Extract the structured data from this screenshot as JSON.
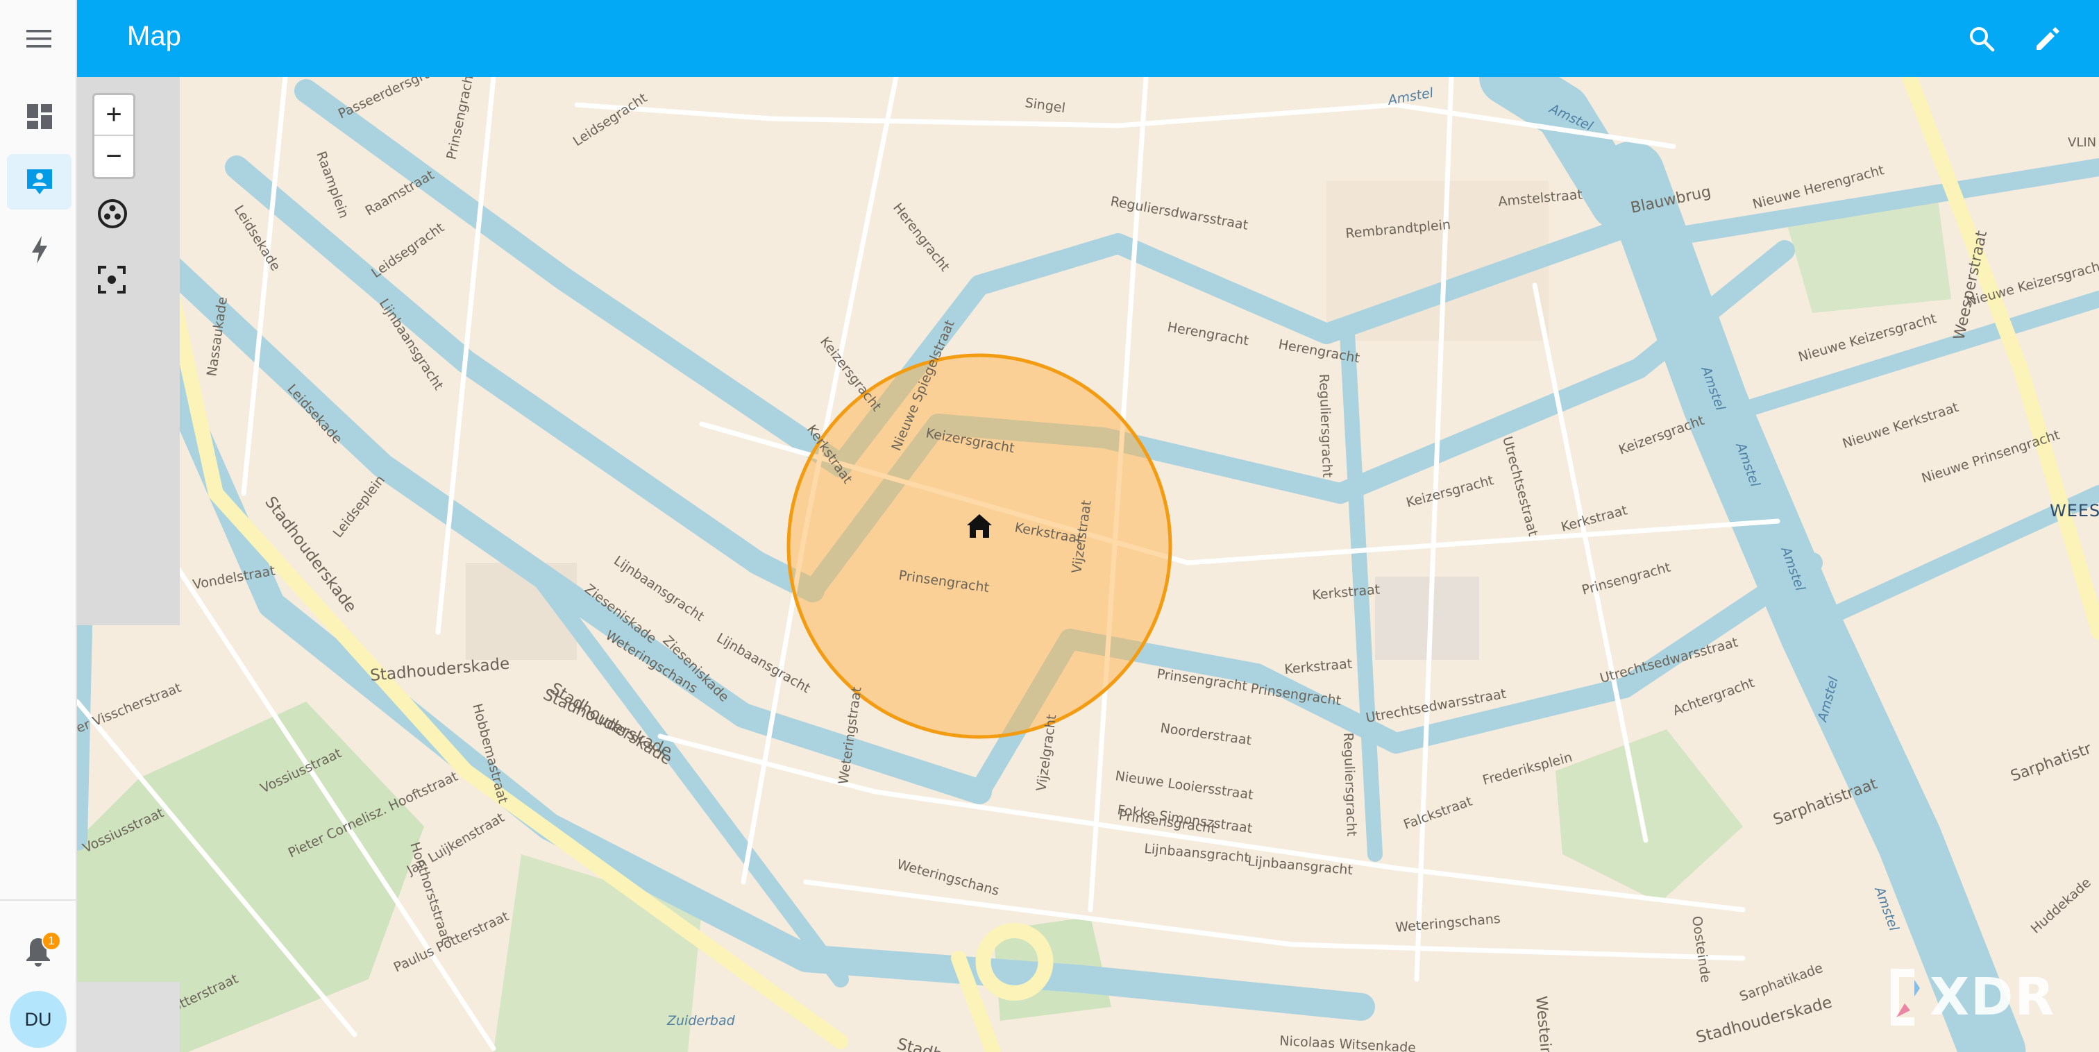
{
  "header": {
    "title": "Map"
  },
  "sidebar": {
    "notification_count": "1",
    "avatar_initials": "DU"
  },
  "map": {
    "zoom_in_label": "+",
    "zoom_out_label": "−",
    "watermark": "XDR",
    "streets": {
      "s1": "Singel",
      "s2": "Passeerdersgracht",
      "s3": "Leidsegracht",
      "s4": "Raamstraat",
      "s5": "Raamplein",
      "s6": "Prinsengracht",
      "s7": "Leidsekade",
      "s8": "Leidsegracht",
      "s9": "Lijnbaansgracht",
      "s10": "Nassaukade",
      "s11": "Leidsekade",
      "s12": "Leidseplein",
      "s13": "Stadhouderskade",
      "s14": "Vondelstraat",
      "s15": "Herengracht",
      "s16": "Reguliersdwarsstraat",
      "s17": "Rembrandtplein",
      "s18": "Amstelstraat",
      "s19": "Blauwbrug",
      "s20": "Nieuwe Herengracht",
      "s21": "Amstel",
      "s22": "Herengracht",
      "s23": "Herengracht",
      "s24": "Keizersgracht",
      "s25": "Nieuwe Spiegelstraat",
      "s26": "Keizersgracht",
      "s27": "Kerkstraat",
      "s28": "Kerkstraat",
      "s29": "Vijzelstraat",
      "s30": "Prinsengracht",
      "s31": "Reguliersgracht",
      "s32": "Utrechtsestraat",
      "s33": "Keizersgracht",
      "s34": "Keizersgracht",
      "s35": "Kerkstraat",
      "s36": "Kerkstraat",
      "s37": "Prinsengracht",
      "s38": "Nieuwe Keizersgracht",
      "s39": "Nieuwe Kerkstraat",
      "s40": "Nieuwe Prinsengracht",
      "s41": "Weesperstraat",
      "s42": "Nieuwe Keizersgracht",
      "s43": "Lijnbaansgracht",
      "s44": "Zieseniskade",
      "s45": "Zieseniskade",
      "s46": "Lijnbaansgracht",
      "s47": "Weteringschans",
      "s48": "Stadhouderskade",
      "s49": "Stadhouderskade",
      "s50": "Prinsengracht",
      "s51": "Prinsengracht",
      "s52": "Noorderstraat",
      "s53": "Utrechtsedwarsstraat",
      "s54": "Utrechtsedwarsstraat",
      "s55": "Achtergracht",
      "s56": "Frederiksplein",
      "s57": "Weteringstraat",
      "s58": "Vijzelgracht",
      "s59": "Nieuwe Looiersstraat",
      "s60": "Fokke Simonszstraat",
      "s61": "Lijnbaansgracht",
      "s62": "Lijnbaansgracht",
      "s63": "Falckstraat",
      "s64": "Sarphatistraat",
      "s65": "Sarphatistr",
      "s66": "Amstel",
      "s67": "Amstel",
      "s68": "Weteringschans",
      "s69": "Weteringschans",
      "s70": "Nicolaas Witsenkade",
      "s71": "Stadhouderskade",
      "s72": "Stadhouderskade",
      "s73": "Sarphatikade",
      "s74": "Oosteinde",
      "s75": "Huddekade",
      "s76": "Westeinde",
      "s77": "Hobbemastraat",
      "s78": "Vossiusstraat",
      "s79": "Vossiusstraat",
      "s80": "Pieter Cornelisz. Hooftstraat",
      "s81": "Jan Luijkenstraat",
      "s82": "Honthorststraat",
      "s83": "Paulus Potterstraat",
      "s84": "Paulus Potterstraat",
      "s85": "er Visscherstraat",
      "s86": "Stadhouderskade",
      "s87": "Amstel",
      "s88": "Amstel",
      "s89": "Amstel",
      "s90": "Kerkstraat",
      "s91": "Prinsensgracht",
      "s92": "Amstel",
      "s93": "Reguliersgracht"
    },
    "district_label": "WEES",
    "district_label2": "VLIN",
    "water_label": "Zuiderbad"
  },
  "colors": {
    "header": "#03a9f4",
    "zone_fill": "#ffb14a",
    "zone_stroke": "#f39c12",
    "water": "#aad3df",
    "land": "#f5ecdd",
    "park": "#cde4bd",
    "major_road": "#fbf3b8"
  }
}
